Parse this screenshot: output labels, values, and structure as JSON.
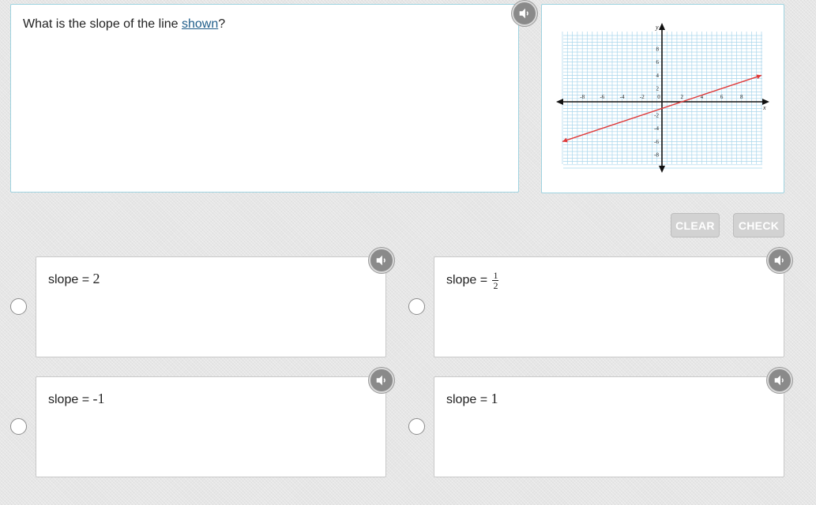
{
  "question": {
    "text_before": "What is the slope of the line ",
    "link_text": "shown",
    "text_after": "?"
  },
  "graph": {
    "x_label": "x",
    "y_label": "y",
    "x_ticks": [
      "-8",
      "-6",
      "-4",
      "-2",
      "0",
      "2",
      "4",
      "6",
      "8"
    ],
    "y_ticks": [
      "8",
      "6",
      "4",
      "2",
      "-2",
      "-4",
      "-6",
      "-8"
    ],
    "range": [
      -10,
      10
    ],
    "line": {
      "from": [
        -10,
        -6
      ],
      "to": [
        10,
        4
      ],
      "color": "#e03a3a"
    },
    "grid_color": "#a9d6ec"
  },
  "buttons": {
    "clear": "CLEAR",
    "check": "CHECK"
  },
  "choices": [
    {
      "label": "slope = ",
      "value": "2"
    },
    {
      "label": "slope = ",
      "num": "1",
      "den": "2"
    },
    {
      "label": "slope = ",
      "value": "-1"
    },
    {
      "label": "slope = ",
      "value": "1"
    }
  ],
  "icons": {
    "speaker": "speaker-icon"
  }
}
